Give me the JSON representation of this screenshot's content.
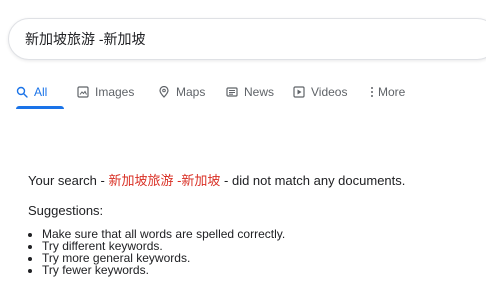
{
  "search": {
    "value": "新加坡旅游 -新加坡"
  },
  "tabs": [
    {
      "label": "All",
      "icon": "search-icon",
      "active": true
    },
    {
      "label": "Images",
      "icon": "image-icon",
      "active": false
    },
    {
      "label": "Maps",
      "icon": "map-pin-icon",
      "active": false
    },
    {
      "label": "News",
      "icon": "news-icon",
      "active": false
    },
    {
      "label": "Videos",
      "icon": "play-icon",
      "active": false
    },
    {
      "label": "More",
      "icon": "more-vert-icon",
      "active": false
    }
  ],
  "results": {
    "nomatch_prefix": "Your search - ",
    "nomatch_query": "新加坡旅游 -新加坡",
    "nomatch_suffix": " - did not match any documents.",
    "suggestions_title": "Suggestions:",
    "suggestions": [
      "Make sure that all words are spelled correctly.",
      "Try different keywords.",
      "Try more general keywords.",
      "Try fewer keywords."
    ]
  },
  "colors": {
    "accent": "#1a73e8",
    "query_highlight": "#d93025",
    "text": "#202124",
    "muted": "#5f6368"
  }
}
